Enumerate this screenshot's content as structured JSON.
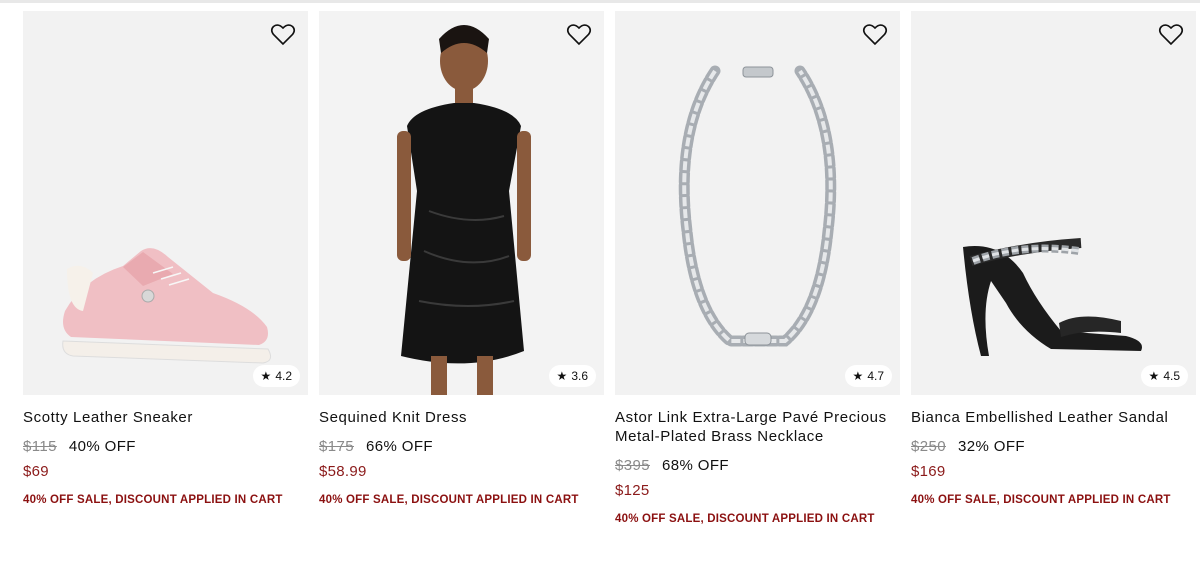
{
  "products": [
    {
      "title": "Scotty Leather Sneaker",
      "original_price": "$115",
      "discount": "40% OFF",
      "sale_price": "$69",
      "promo": "40% OFF SALE, DISCOUNT APPLIED IN CART",
      "rating": "4.2",
      "icon": "sneaker-image"
    },
    {
      "title": "Sequined Knit Dress",
      "original_price": "$175",
      "discount": "66% OFF",
      "sale_price": "$58.99",
      "promo": "40% OFF SALE, DISCOUNT APPLIED IN CART",
      "rating": "3.6",
      "icon": "dress-image"
    },
    {
      "title": "Astor Link Extra-Large Pavé Precious Metal-Plated Brass Necklace",
      "original_price": "$395",
      "discount": "68% OFF",
      "sale_price": "$125",
      "promo": "40% OFF SALE, DISCOUNT APPLIED IN CART",
      "rating": "4.7",
      "icon": "necklace-image"
    },
    {
      "title": "Bianca Embellished Leather Sandal",
      "original_price": "$250",
      "discount": "32% OFF",
      "sale_price": "$169",
      "promo": "40% OFF SALE, DISCOUNT APPLIED IN CART",
      "rating": "4.5",
      "icon": "sandal-image"
    }
  ],
  "colors": {
    "sale": "#8b1a1a",
    "promo": "#8b1010",
    "tile_bg": "#f2f2f2"
  },
  "rating_icon": "star-icon",
  "wishlist_icon": "heart-icon"
}
